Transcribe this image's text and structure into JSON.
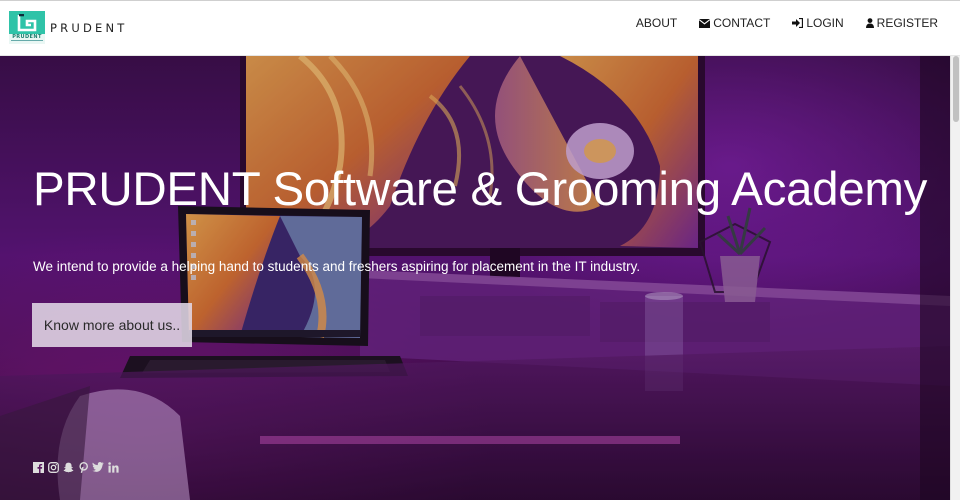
{
  "brand": {
    "name": "PRUDENT",
    "logo_text": "PRUDENT",
    "brand_color": "#2fc3a8"
  },
  "nav": {
    "items": [
      {
        "label": "ABOUT",
        "icon": ""
      },
      {
        "label": "CONTACT",
        "icon": "envelope-icon"
      },
      {
        "label": "LOGIN",
        "icon": "sign-in-icon"
      },
      {
        "label": "REGISTER",
        "icon": "user-icon"
      }
    ]
  },
  "hero": {
    "title": "PRUDENT Software & Grooming Academy",
    "subtitle": "We intend to provide a helping hand to students and freshers aspiring for placement in the IT industry.",
    "button_label": "Know more about us..",
    "social_icons": [
      "facebook-icon",
      "instagram-icon",
      "snapchat-icon",
      "pinterest-icon",
      "twitter-icon",
      "linkedin-icon"
    ]
  }
}
